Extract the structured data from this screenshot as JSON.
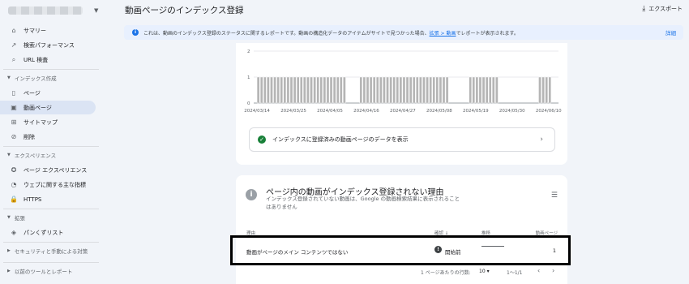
{
  "sidebar": {
    "items": [
      {
        "label": "サマリー",
        "icon": "home-icon",
        "glyph": "⌂"
      },
      {
        "label": "検索パフォーマンス",
        "icon": "trend-icon",
        "glyph": "↗"
      },
      {
        "label": "URL 検査",
        "icon": "search-icon",
        "glyph": "⌕"
      }
    ],
    "sections": [
      {
        "label": "インデックス作成",
        "items": [
          {
            "label": "ページ",
            "icon": "page-icon",
            "glyph": "▯",
            "active": false
          },
          {
            "label": "動画ページ",
            "icon": "video-page-icon",
            "glyph": "▣",
            "active": true
          },
          {
            "label": "サイトマップ",
            "icon": "sitemap-icon",
            "glyph": "⊞",
            "active": false
          },
          {
            "label": "削除",
            "icon": "removal-icon",
            "glyph": "⊘",
            "active": false
          }
        ]
      },
      {
        "label": "エクスペリエンス",
        "items": [
          {
            "label": "ページ エクスペリエンス",
            "icon": "experience-icon",
            "glyph": "✪"
          },
          {
            "label": "ウェブに関する主な指標",
            "icon": "vitals-icon",
            "glyph": "◔"
          },
          {
            "label": "HTTPS",
            "icon": "lock-icon",
            "glyph": "🔒"
          }
        ]
      },
      {
        "label": "拡張",
        "items": [
          {
            "label": "パンくずリスト",
            "icon": "layers-icon",
            "glyph": "◈"
          }
        ]
      }
    ],
    "collapsed_sections": [
      "セキュリティと手動による対策",
      "以前のツールとレポート"
    ]
  },
  "header": {
    "title": "動画ページのインデックス登録",
    "export_label": "エクスポート"
  },
  "banner": {
    "text_before": "これは、動画のインデックス登録のステータスに関するレポートです。動画の構造化データのアイテムがサイトで見つかった場合、",
    "link": "拡張 > 動画",
    "text_after": "でレポートが表示されます。",
    "detail": "詳細"
  },
  "chart_data": {
    "type": "bar",
    "ylim": [
      0,
      2
    ],
    "y_ticks": [
      "0",
      "1",
      "2"
    ],
    "x_tick_labels": [
      "2024/03/14",
      "2024/03/25",
      "2024/04/05",
      "2024/04/16",
      "2024/04/27",
      "2024/05/08",
      "2024/05/19",
      "2024/05/30",
      "2024/06/10"
    ],
    "x_start": "2024/03/13",
    "x_end": "2024/06/13",
    "segments": [
      {
        "from": "2024/03/14",
        "to": "2024/04/09",
        "value": 1
      },
      {
        "from": "2024/04/14",
        "to": "2024/05/10",
        "value": 1
      },
      {
        "from": "2024/05/17",
        "to": "2024/05/25",
        "value": 1
      },
      {
        "from": "2024/06/07",
        "to": "2024/06/10",
        "value": 1
      }
    ],
    "bar_color": "#b5b5b5"
  },
  "indexed_link": "インデックスに登録済みの動画ページのデータを表示",
  "reasons": {
    "title": "ページ内の動画がインデックス登録されない理由",
    "subtitle": "インデックス登録されていない動画は、Google の動画検索結果に表示されることはありません",
    "columns": {
      "reason": "理由",
      "validation": "確認",
      "trend": "推移",
      "pages": "動画ページ"
    },
    "rows": [
      {
        "reason": "動画がページのメイン コンテンツではない",
        "status": "開始前",
        "count": "1"
      }
    ],
    "pager": {
      "rows_label": "1 ページあたりの行数:",
      "rows_value": "10",
      "range": "1〜1/1"
    }
  }
}
